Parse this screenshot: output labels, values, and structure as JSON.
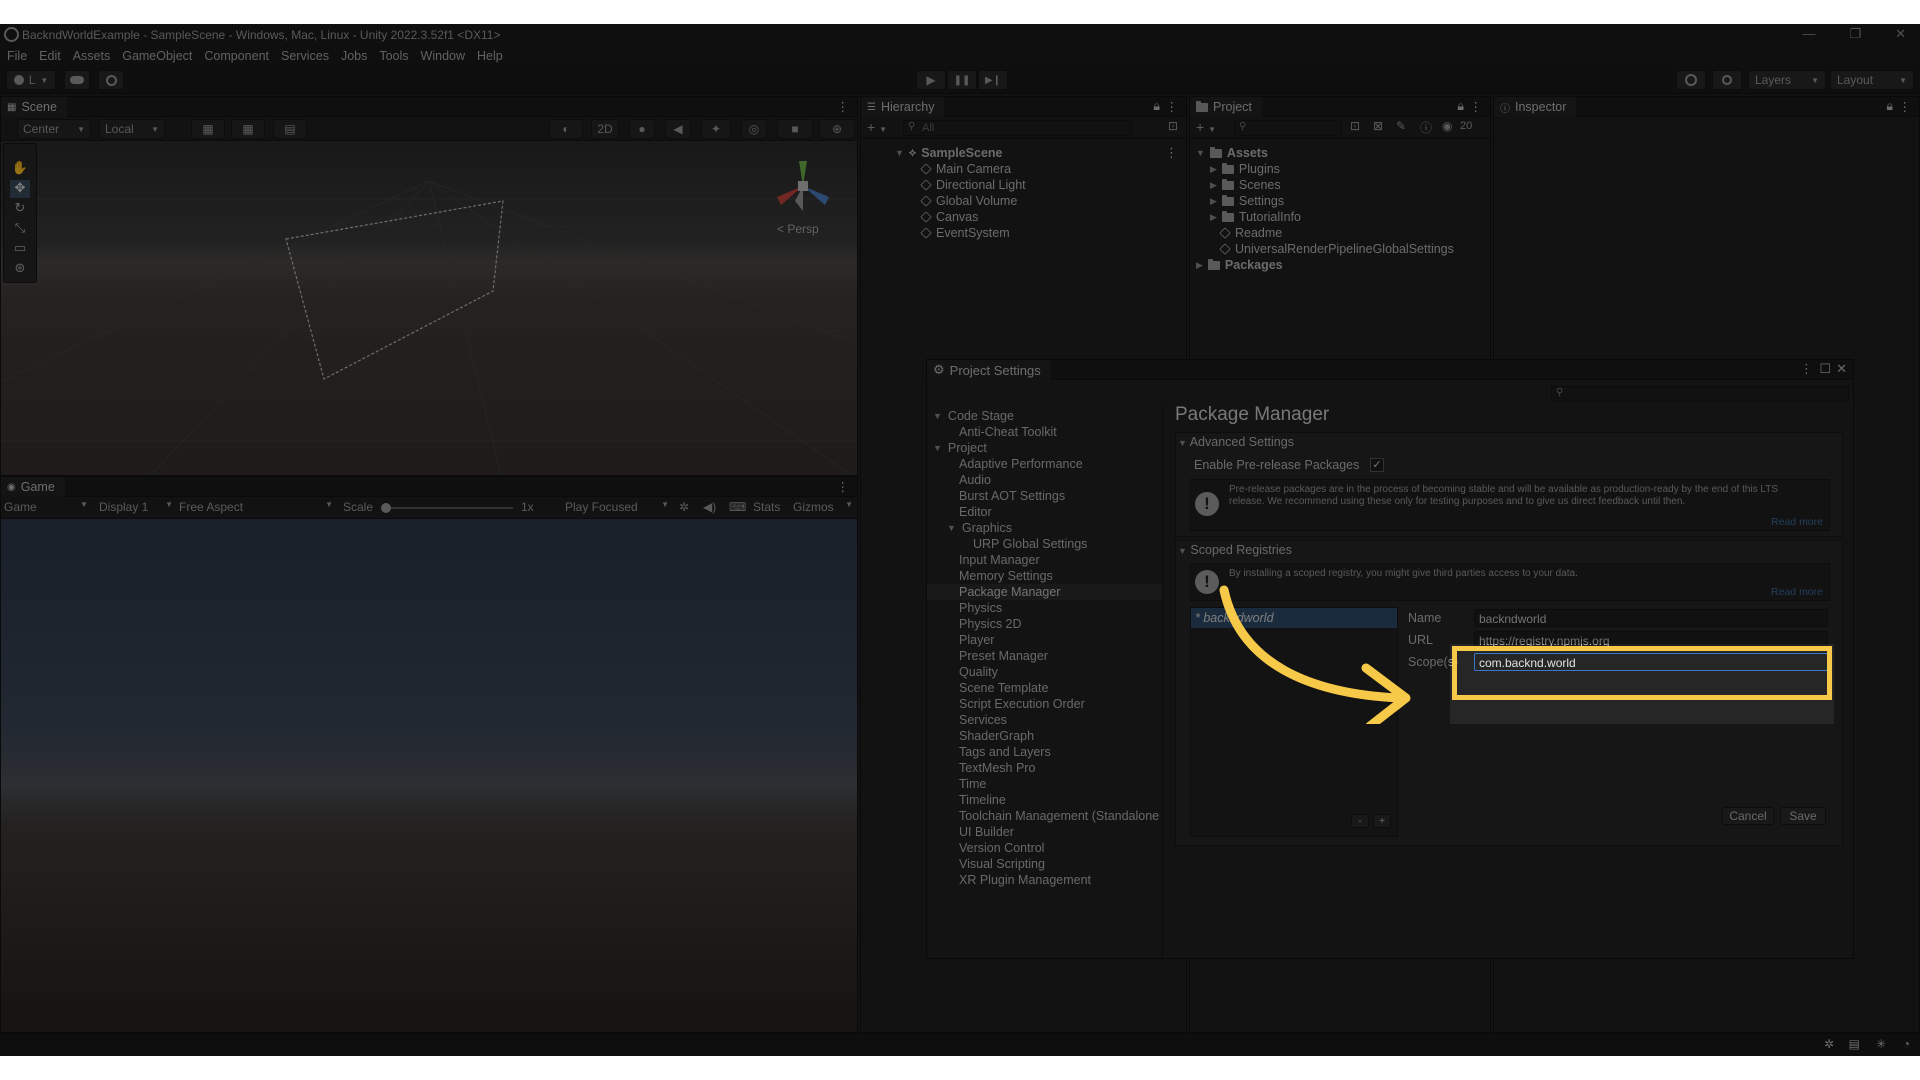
{
  "window": {
    "title": "BackndWorldExample - SampleScene - Windows, Mac, Linux - Unity 2022.3.52f1 <DX11>",
    "controls": [
      "—",
      "❐",
      "✕"
    ]
  },
  "menu": [
    "File",
    "Edit",
    "Assets",
    "GameObject",
    "Component",
    "Services",
    "Jobs",
    "Tools",
    "Window",
    "Help"
  ],
  "toolbar": {
    "account_label": "L",
    "layers_label": "Layers",
    "layout_label": "Layout",
    "play_icon": "▶",
    "pause_icon": "❚❚",
    "step_icon": "▶❙"
  },
  "scene": {
    "tab": "Scene",
    "pivot_label": "Center",
    "space_label": "Local",
    "mode_2d": "2D",
    "persp_label": "Persp"
  },
  "game": {
    "tab": "Game",
    "mode": "Game",
    "display": "Display 1",
    "aspect": "Free Aspect",
    "scale_label": "Scale",
    "scale_value": "1x",
    "play_focus": "Play Focused",
    "stats": "Stats",
    "gizmos": "Gizmos"
  },
  "hierarchy": {
    "tab": "Hierarchy",
    "search_placeholder": "All",
    "scene": "SampleScene",
    "items": [
      "Main Camera",
      "Directional Light",
      "Global Volume",
      "Canvas",
      "EventSystem"
    ]
  },
  "project": {
    "tab": "Project",
    "badge_count": "20",
    "root": "Assets",
    "folders": [
      "Plugins",
      "Scenes",
      "Settings",
      "TutorialInfo"
    ],
    "files": [
      "Readme",
      "UniversalRenderPipelineGlobalSettings"
    ],
    "packages": "Packages"
  },
  "inspector": {
    "tab": "Inspector"
  },
  "project_settings": {
    "title": "Project Settings",
    "nav": {
      "code_stage": "Code Stage",
      "anti_cheat": "Anti-Cheat Toolkit",
      "project": "Project",
      "items_a": [
        "Adaptive Performance",
        "Audio",
        "Burst AOT Settings",
        "Editor"
      ],
      "graphics": "Graphics",
      "urp": "URP Global Settings",
      "items_b": [
        "Input Manager",
        "Memory Settings",
        "Package Manager",
        "Physics",
        "Physics 2D",
        "Player",
        "Preset Manager",
        "Quality",
        "Scene Template",
        "Script Execution Order",
        "Services",
        "ShaderGraph",
        "Tags and Layers",
        "TextMesh Pro",
        "Time",
        "Timeline",
        "Toolchain Management (Standalone",
        "UI Builder",
        "Version Control",
        "Visual Scripting",
        "XR Plugin Management"
      ],
      "selected": "Package Manager"
    },
    "heading": "Package Manager",
    "advanced": {
      "title": "Advanced Settings",
      "prerelease_label": "Enable Pre-release Packages",
      "prerelease_checked": true,
      "info_line1": "Pre-release packages are in the process of becoming stable and will be available as production-ready by the end of this LTS",
      "info_line2": "release. We recommend using these only for testing purposes and to give us direct feedback until then.",
      "read_more": "Read more"
    },
    "scoped": {
      "title": "Scoped Registries",
      "info": "By installing a scoped registry, you might give third parties access to your data.",
      "read_more": "Read more",
      "registry_item": "* backndworld",
      "name_label": "Name",
      "name_value": "backndworld",
      "url_label": "URL",
      "url_value": "https://registry.npmjs.org",
      "scope_label": "Scope(s)",
      "scope_value": "com.backnd.world",
      "minus": "-",
      "plus": "+",
      "cancel": "Cancel",
      "save": "Save"
    }
  },
  "annotation_colors": {
    "highlight": "#f7c948",
    "overlay": "#000000"
  }
}
